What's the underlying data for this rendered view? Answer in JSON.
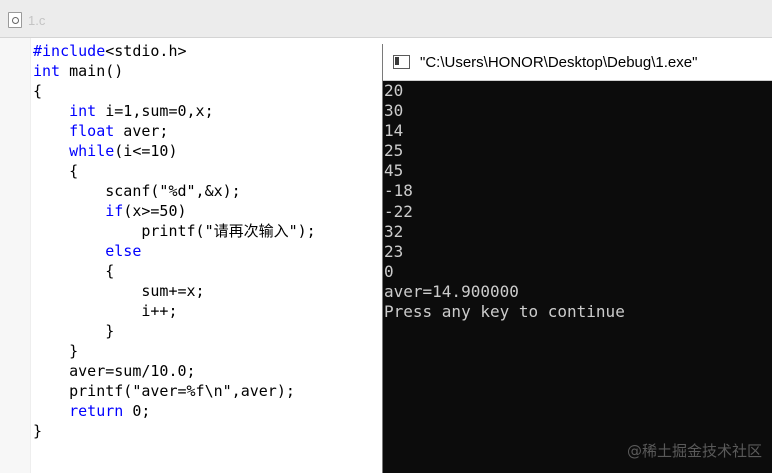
{
  "editor": {
    "tab_label": "1.c",
    "code_lines": [
      [
        {
          "t": "#include",
          "k": "pre"
        },
        {
          "t": "<stdio.h>",
          "k": ""
        }
      ],
      [
        {
          "t": "int",
          "k": "kw"
        },
        {
          "t": " main()",
          "k": ""
        }
      ],
      [
        {
          "t": "{",
          "k": ""
        }
      ],
      [
        {
          "t": "    ",
          "k": ""
        },
        {
          "t": "int",
          "k": "kw"
        },
        {
          "t": " i=1,sum=0,x;",
          "k": ""
        }
      ],
      [
        {
          "t": "    ",
          "k": ""
        },
        {
          "t": "float",
          "k": "kw"
        },
        {
          "t": " aver;",
          "k": ""
        }
      ],
      [
        {
          "t": "    ",
          "k": ""
        },
        {
          "t": "while",
          "k": "kw"
        },
        {
          "t": "(i<=10)",
          "k": ""
        }
      ],
      [
        {
          "t": "    {",
          "k": ""
        }
      ],
      [
        {
          "t": "        scanf(\"%d\",&x);",
          "k": ""
        }
      ],
      [
        {
          "t": "        ",
          "k": ""
        },
        {
          "t": "if",
          "k": "kw"
        },
        {
          "t": "(x>=50)",
          "k": ""
        }
      ],
      [
        {
          "t": "            printf(\"请再次输入\");",
          "k": ""
        }
      ],
      [
        {
          "t": "        ",
          "k": ""
        },
        {
          "t": "else",
          "k": "kw"
        }
      ],
      [
        {
          "t": "        {",
          "k": ""
        }
      ],
      [
        {
          "t": "            sum+=x;",
          "k": ""
        }
      ],
      [
        {
          "t": "            i++;",
          "k": ""
        }
      ],
      [
        {
          "t": "        }",
          "k": ""
        }
      ],
      [
        {
          "t": "    }",
          "k": ""
        }
      ],
      [
        {
          "t": "    aver=sum/10.0;",
          "k": ""
        }
      ],
      [
        {
          "t": "    printf(\"aver=%f\\n\",aver);",
          "k": ""
        }
      ],
      [
        {
          "t": "    ",
          "k": ""
        },
        {
          "t": "return",
          "k": "kw"
        },
        {
          "t": " 0;",
          "k": ""
        }
      ],
      [
        {
          "t": "}",
          "k": ""
        }
      ]
    ]
  },
  "console": {
    "title": "\"C:\\Users\\HONOR\\Desktop\\Debug\\1.exe\"",
    "output_lines": [
      "20",
      "30",
      "14",
      "25",
      "45",
      "-18",
      "-22",
      "32",
      "23",
      "0",
      "aver=14.900000",
      "Press any key to continue"
    ]
  },
  "watermark": "@稀土掘金技术社区",
  "colors": {
    "keyword": "#0000ff",
    "console_bg": "#0c0c0c",
    "console_text": "#cccccc"
  }
}
